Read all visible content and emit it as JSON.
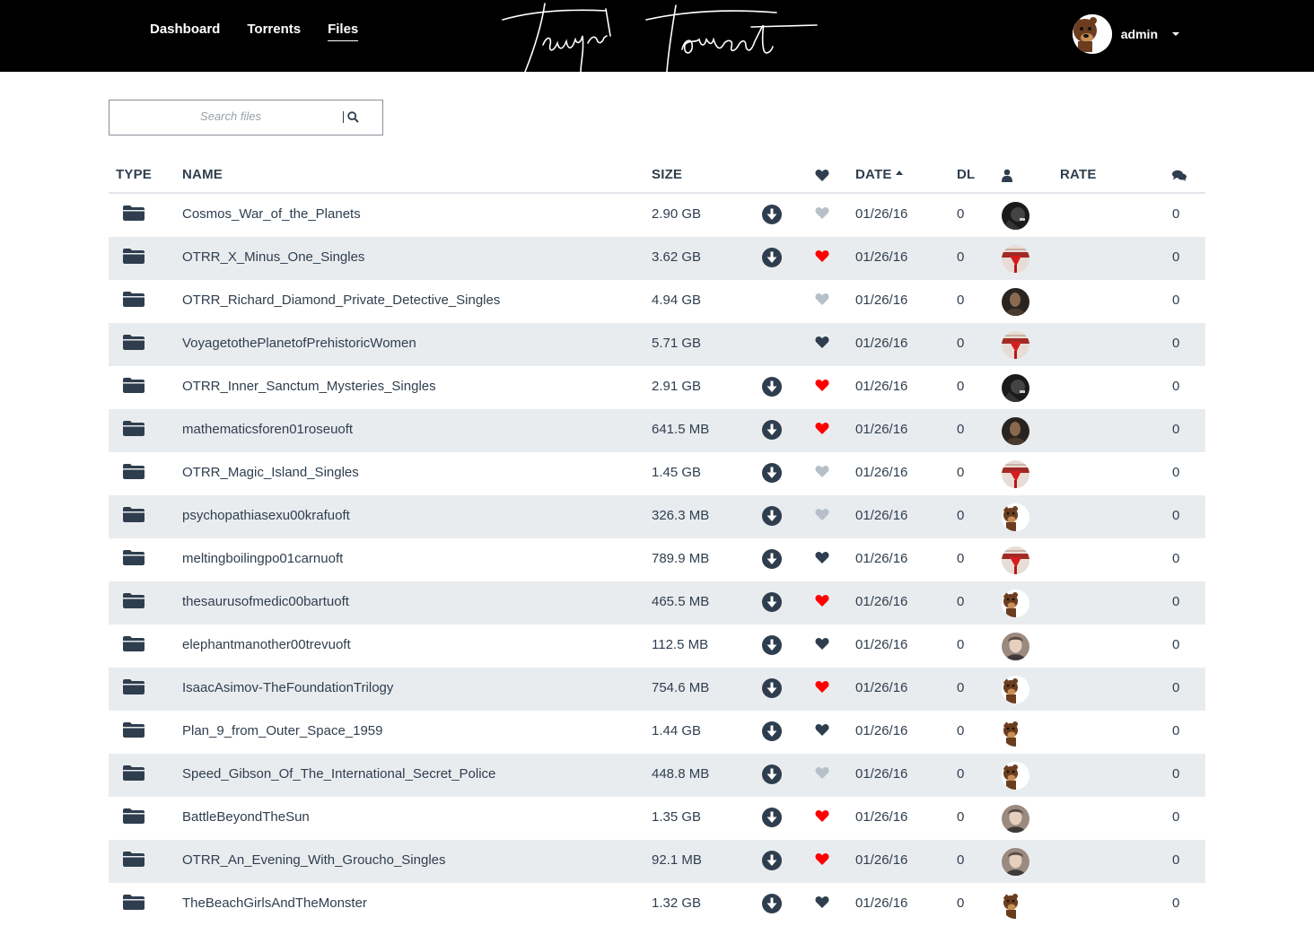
{
  "colors": {
    "topbar": "#000000",
    "text": "#2f3e4e",
    "alt_row": "#e9ecef",
    "heart_red": "#ff0000",
    "heart_grey": "#b7c0c8",
    "heart_dark": "#2f3e4e"
  },
  "nav": {
    "items": [
      "Dashboard",
      "Torrents",
      "Files"
    ],
    "active": "Files"
  },
  "logo": {
    "text": "Teurpi Torrent"
  },
  "user": {
    "name": "admin"
  },
  "search": {
    "placeholder": "Search files",
    "icon": "search-icon"
  },
  "table": {
    "headers": {
      "type": "TYPE",
      "name": "NAME",
      "size": "SIZE",
      "fav": "heart-icon",
      "date": "DATE",
      "dl": "DL",
      "user": "user-icon",
      "rate": "RATE",
      "comments": "comments-icon"
    },
    "sort": {
      "column": "DATE",
      "direction": "asc"
    },
    "rows": [
      {
        "name": "Cosmos_War_of_the_Planets",
        "size": "2.90 GB",
        "download": true,
        "fav": "grey",
        "date": "01/26/16",
        "dl": "0",
        "avatar": "dark",
        "comments": "0"
      },
      {
        "name": "OTRR_X_Minus_One_Singles",
        "size": "3.62 GB",
        "download": true,
        "fav": "red",
        "date": "01/26/16",
        "dl": "0",
        "avatar": "red",
        "comments": "0"
      },
      {
        "name": "OTRR_Richard_Diamond_Private_Detective_Singles",
        "size": "4.94 GB",
        "download": false,
        "fav": "grey",
        "date": "01/26/16",
        "dl": "0",
        "avatar": "brown",
        "comments": "0"
      },
      {
        "name": "VoyagetothePlanetofPrehistoricWomen",
        "size": "5.71 GB",
        "download": false,
        "fav": "dark",
        "date": "01/26/16",
        "dl": "0",
        "avatar": "red",
        "comments": "0"
      },
      {
        "name": "OTRR_Inner_Sanctum_Mysteries_Singles",
        "size": "2.91 GB",
        "download": true,
        "fav": "red",
        "date": "01/26/16",
        "dl": "0",
        "avatar": "dark",
        "comments": "0"
      },
      {
        "name": "mathematicsforen01roseuoft",
        "size": "641.5 MB",
        "download": true,
        "fav": "red",
        "date": "01/26/16",
        "dl": "0",
        "avatar": "brown",
        "comments": "0"
      },
      {
        "name": "OTRR_Magic_Island_Singles",
        "size": "1.45 GB",
        "download": true,
        "fav": "grey",
        "date": "01/26/16",
        "dl": "0",
        "avatar": "red",
        "comments": "0"
      },
      {
        "name": "psychopathiasexu00krafuoft",
        "size": "326.3 MB",
        "download": true,
        "fav": "grey",
        "date": "01/26/16",
        "dl": "0",
        "avatar": "bear",
        "comments": "0"
      },
      {
        "name": "meltingboilingpo01carnuoft",
        "size": "789.9 MB",
        "download": true,
        "fav": "dark",
        "date": "01/26/16",
        "dl": "0",
        "avatar": "red",
        "comments": "0"
      },
      {
        "name": "thesaurusofmedic00bartuoft",
        "size": "465.5 MB",
        "download": true,
        "fav": "red",
        "date": "01/26/16",
        "dl": "0",
        "avatar": "bear",
        "comments": "0"
      },
      {
        "name": "elephantmanother00trevuoft",
        "size": "112.5 MB",
        "download": true,
        "fav": "dark",
        "date": "01/26/16",
        "dl": "0",
        "avatar": "face",
        "comments": "0"
      },
      {
        "name": "IsaacAsimov-TheFoundationTrilogy",
        "size": "754.6 MB",
        "download": true,
        "fav": "red",
        "date": "01/26/16",
        "dl": "0",
        "avatar": "bear",
        "comments": "0"
      },
      {
        "name": "Plan_9_from_Outer_Space_1959",
        "size": "1.44 GB",
        "download": true,
        "fav": "dark",
        "date": "01/26/16",
        "dl": "0",
        "avatar": "bear",
        "comments": "0"
      },
      {
        "name": "Speed_Gibson_Of_The_International_Secret_Police",
        "size": "448.8 MB",
        "download": true,
        "fav": "grey",
        "date": "01/26/16",
        "dl": "0",
        "avatar": "bear",
        "comments": "0"
      },
      {
        "name": "BattleBeyondTheSun",
        "size": "1.35 GB",
        "download": true,
        "fav": "red",
        "date": "01/26/16",
        "dl": "0",
        "avatar": "face",
        "comments": "0"
      },
      {
        "name": "OTRR_An_Evening_With_Groucho_Singles",
        "size": "92.1 MB",
        "download": true,
        "fav": "red",
        "date": "01/26/16",
        "dl": "0",
        "avatar": "face",
        "comments": "0"
      },
      {
        "name": "TheBeachGirlsAndTheMonster",
        "size": "1.32 GB",
        "download": true,
        "fav": "dark",
        "date": "01/26/16",
        "dl": "0",
        "avatar": "bear",
        "comments": "0"
      }
    ]
  }
}
